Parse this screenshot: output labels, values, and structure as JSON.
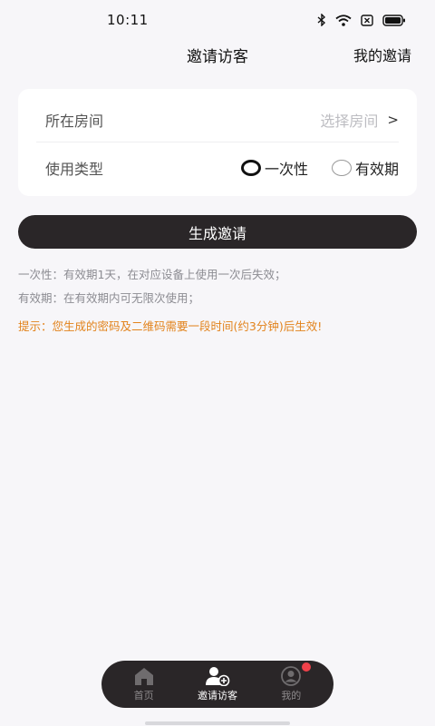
{
  "status_bar": {
    "time": "10:11",
    "icons": [
      "bluetooth-icon",
      "wifi-icon",
      "sim-x-icon",
      "battery-icon"
    ]
  },
  "nav": {
    "title": "邀请访客",
    "right_action": "我的邀请"
  },
  "form": {
    "room": {
      "label": "所在房间",
      "placeholder": "选择房间",
      "chevron": ">"
    },
    "type": {
      "label": "使用类型",
      "options": [
        {
          "label": "一次性",
          "selected": true
        },
        {
          "label": "有效期",
          "selected": false
        }
      ]
    }
  },
  "generate_button": "生成邀请",
  "notes": [
    "一次性：有效期1天，在对应设备上使用一次后失效；",
    "有效期：在有效期内可无限次使用；"
  ],
  "tip": "提示：您生成的密码及二维码需要一段时间(约3分钟)后生效!",
  "tabs": [
    {
      "label": "首页",
      "icon": "home-icon",
      "active": false
    },
    {
      "label": "邀请访客",
      "icon": "add-user-icon",
      "active": true
    },
    {
      "label": "我的",
      "icon": "profile-icon",
      "active": false,
      "badge": true
    }
  ],
  "colors": {
    "background": "#f7f6f9",
    "dark": "#2a2628",
    "tip": "#e2831c",
    "badge": "#f0414a",
    "muted": "#8c8c92"
  }
}
